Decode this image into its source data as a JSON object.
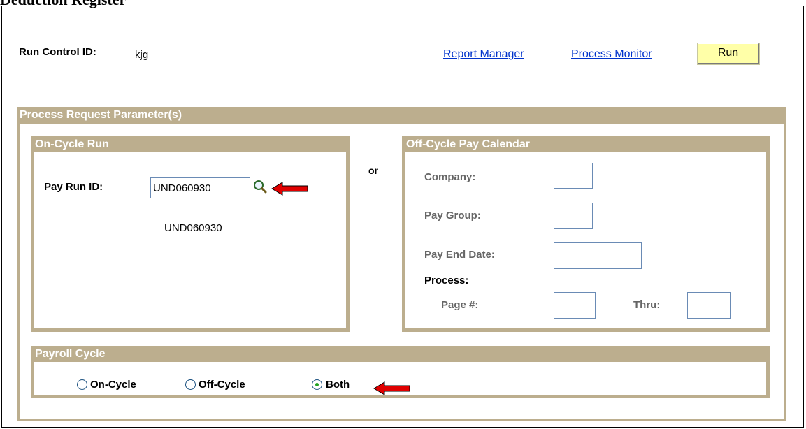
{
  "page": {
    "title": "Deduction Register"
  },
  "header": {
    "run_control_label": "Run Control ID:",
    "run_control_value": "kjg",
    "report_manager_link": "Report Manager",
    "process_monitor_link": "Process Monitor",
    "run_button": "Run"
  },
  "params": {
    "title": "Process Request Parameter(s)",
    "or_label": "or"
  },
  "on_cycle": {
    "title": "On-Cycle Run",
    "pay_run_id_label": "Pay Run ID:",
    "pay_run_id_value": "UND060930",
    "pay_run_id_description": "UND060930",
    "lookup_icon": "magnifier-lookup-icon"
  },
  "off_cycle": {
    "title": "Off-Cycle Pay Calendar",
    "company_label": "Company:",
    "pay_group_label": "Pay Group:",
    "pay_end_date_label": "Pay End Date:",
    "process_label": "Process:",
    "page_label": "Page #:",
    "thru_label": "Thru:"
  },
  "payroll_cycle": {
    "title": "Payroll Cycle",
    "options": [
      "On-Cycle",
      "Off-Cycle",
      "Both"
    ],
    "selected": "Both"
  },
  "colors": {
    "group_header": "#bcae8e",
    "run_button": "#ffffa8",
    "link": "#0033cc",
    "annotation_arrow": "#e00000"
  }
}
